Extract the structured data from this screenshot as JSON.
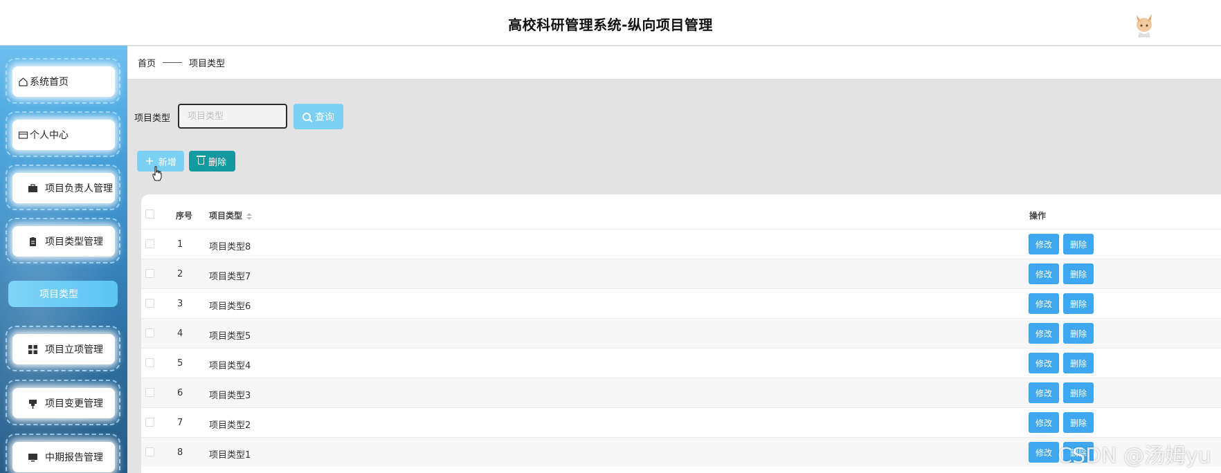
{
  "header": {
    "title": "高校科研管理系统-纵向项目管理"
  },
  "sidebar": {
    "items": [
      {
        "label": "系统首页",
        "icon": "home-icon"
      },
      {
        "label": "个人中心",
        "icon": "card-icon"
      },
      {
        "label": "项目负责人管理",
        "icon": "briefcase-icon"
      },
      {
        "label": "项目类型管理",
        "icon": "clipboard-icon"
      },
      {
        "label": "项目立项管理",
        "icon": "grid-icon"
      },
      {
        "label": "项目变更管理",
        "icon": "pin-icon"
      },
      {
        "label": "中期报告管理",
        "icon": "monitor-icon"
      }
    ],
    "submenu_active": "项目类型"
  },
  "breadcrumb": {
    "home": "首页",
    "current": "项目类型"
  },
  "search": {
    "label": "项目类型",
    "placeholder": "项目类型",
    "button": "查询"
  },
  "actions": {
    "add": "新增",
    "delete": "删除"
  },
  "table": {
    "headers": {
      "index": "序号",
      "type": "项目类型",
      "ops": "操作"
    },
    "edit_label": "修改",
    "delete_label": "删除",
    "rows": [
      {
        "index": "1",
        "type": "项目类型8"
      },
      {
        "index": "2",
        "type": "项目类型7"
      },
      {
        "index": "3",
        "type": "项目类型6"
      },
      {
        "index": "4",
        "type": "项目类型5"
      },
      {
        "index": "5",
        "type": "项目类型4"
      },
      {
        "index": "6",
        "type": "项目类型3"
      },
      {
        "index": "7",
        "type": "项目类型2"
      },
      {
        "index": "8",
        "type": "项目类型1"
      }
    ]
  },
  "watermark": "CSDN @汤姆yu",
  "colors": {
    "primary": "#7cd0f4",
    "teal": "#129aa0",
    "row_button": "#3ea7ef"
  }
}
